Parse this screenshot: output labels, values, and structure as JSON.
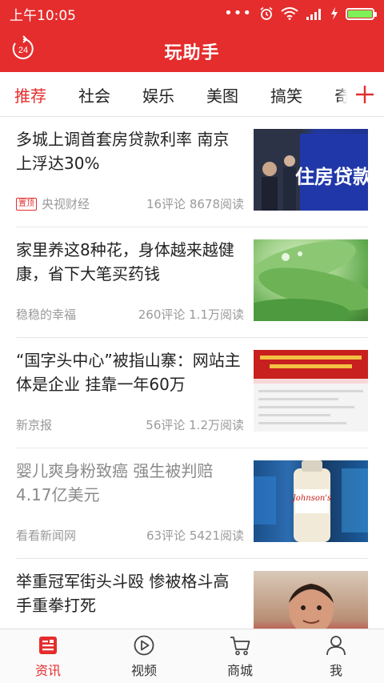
{
  "status_bar": {
    "time": "上午10:05",
    "icons": [
      "more-dots-icon",
      "alarm-icon",
      "wifi-icon",
      "signal-icon",
      "charging-icon",
      "battery-icon"
    ],
    "battery_level": 1.0
  },
  "header": {
    "title": "玩助手",
    "refresh_badge": "24"
  },
  "tabs": {
    "items": [
      {
        "label": "推荐",
        "active": true
      },
      {
        "label": "社会",
        "active": false
      },
      {
        "label": "娱乐",
        "active": false
      },
      {
        "label": "美图",
        "active": false
      },
      {
        "label": "搞笑",
        "active": false
      },
      {
        "label": "奇",
        "active": false
      }
    ],
    "add_icon": "plus-icon"
  },
  "feed": [
    {
      "title": "多城上调首套房贷款利率 南京上浮达30%",
      "pinned": true,
      "pin_label": "置顶",
      "source": "央视财经",
      "stats": "16评论 8678阅读",
      "read": false,
      "thumb_text": "住房贷款"
    },
    {
      "title": "家里养这8种花，身体越来越健康，省下大笔买药钱",
      "pinned": false,
      "source": "稳稳的幸福",
      "stats": "260评论 1.1万阅读",
      "read": false
    },
    {
      "title": "“国字头中心”被指山寨：网站主体是企业 挂靠一年60万",
      "pinned": false,
      "source": "新京报",
      "stats": "56评论 1.2万阅读",
      "read": false
    },
    {
      "title": "婴儿爽身粉致癌 强生被判赔4.17亿美元",
      "pinned": false,
      "source": "看看新闻网",
      "stats": "63评论 5421阅读",
      "read": true,
      "thumb_text": "Johnson's"
    },
    {
      "title": "举重冠军街头斗殴 惨被格斗高手重拳打死",
      "pinned": false,
      "read": false
    }
  ],
  "bottom_nav": [
    {
      "label": "资讯",
      "icon": "news-icon",
      "active": true
    },
    {
      "label": "视频",
      "icon": "play-icon",
      "active": false
    },
    {
      "label": "商城",
      "icon": "cart-icon",
      "active": false
    },
    {
      "label": "我",
      "icon": "user-icon",
      "active": false
    }
  ],
  "colors": {
    "brand": "#e52d2d",
    "text": "#222222",
    "muted": "#9a9a9a"
  }
}
